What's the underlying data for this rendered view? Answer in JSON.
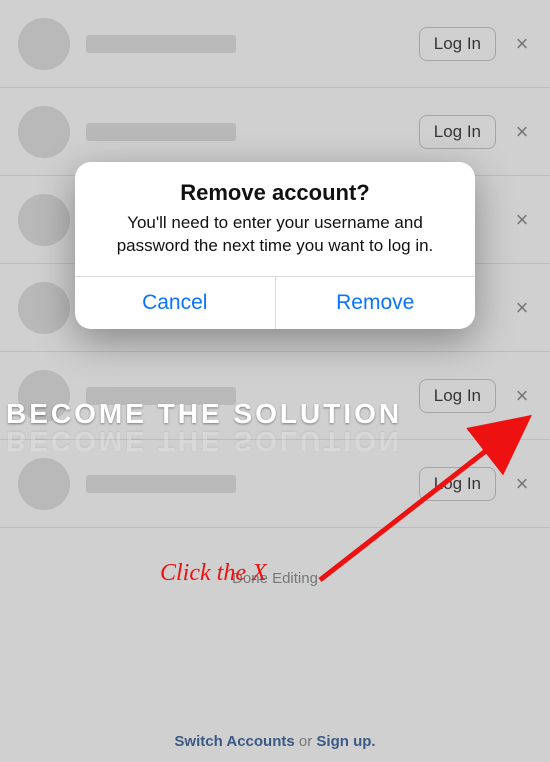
{
  "accounts": [
    {
      "login_label": "Log In"
    },
    {
      "login_label": "Log In"
    },
    {
      "login_label": ""
    },
    {
      "login_label": ""
    },
    {
      "login_label": "Log In"
    },
    {
      "login_label": "Log In"
    }
  ],
  "close_glyph": "×",
  "done_label": "Done Editing",
  "footer": {
    "switch": "Switch Accounts",
    "or": " or ",
    "signup": "Sign up."
  },
  "modal": {
    "title": "Remove account?",
    "message": "You'll need to enter your username and password the next time you want to log in.",
    "cancel": "Cancel",
    "remove": "Remove"
  },
  "watermark": "BECOME THE SOLUTION",
  "annotation": "Click the X"
}
